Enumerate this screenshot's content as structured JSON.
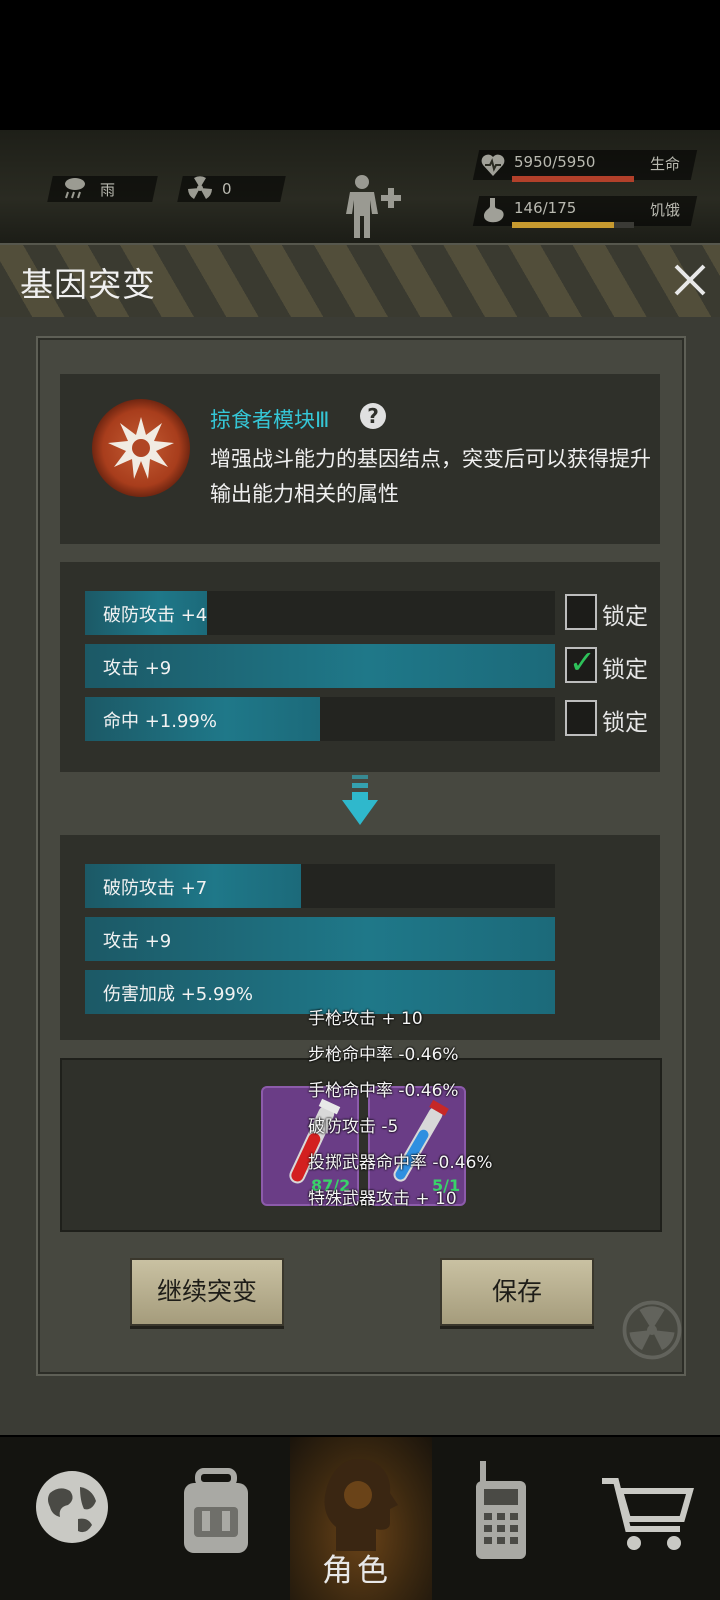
{
  "hud": {
    "weather_label": "雨",
    "radiation_value": "0",
    "hp_text": "5950/5950",
    "hp_label": "生命",
    "hp_fraction": 1.0,
    "hunger_text": "146/175",
    "hunger_label": "饥饿",
    "hunger_fraction": 0.834,
    "colors": {
      "hp": "#b2402a",
      "hunger": "#c79a2f"
    }
  },
  "modal": {
    "title": "基因突变",
    "gene": {
      "name": "掠食者模块Ⅲ",
      "help_symbol": "?",
      "description": "增强战斗能力的基因结点，突变后可以获得提升输出能力相关的属性"
    },
    "current_attributes": [
      {
        "label": "破防攻击 +4",
        "fill": 0.26,
        "lock_label": "锁定",
        "locked": false
      },
      {
        "label": "攻击 +9",
        "fill": 1.0,
        "lock_label": "锁定",
        "locked": true
      },
      {
        "label": "命中 +1.99%",
        "fill": 0.5,
        "lock_label": "锁定",
        "locked": false
      }
    ],
    "new_attributes": [
      {
        "label": "破防攻击 +7",
        "fill": 0.46
      },
      {
        "label": "攻击 +9",
        "fill": 1.0
      },
      {
        "label": "伤害加成 +5.99%",
        "fill": 1.0
      }
    ],
    "materials": [
      {
        "icon": "red-vial-icon",
        "count": "87/2"
      },
      {
        "icon": "blue-vial-icon",
        "count": "5/1"
      }
    ],
    "tooltip_lines": [
      "手枪攻击 + 10",
      "步枪命中率 -0.46%",
      "手枪命中率 -0.46%",
      "破防攻击 -5",
      "投掷武器命中率 -0.46%",
      "特殊武器攻击 + 10"
    ],
    "buttons": {
      "continue": "继续突变",
      "save": "保存"
    }
  },
  "nav": {
    "items": [
      {
        "icon": "globe-icon",
        "label": ""
      },
      {
        "icon": "backpack-icon",
        "label": ""
      },
      {
        "icon": "character-icon",
        "label": "角色",
        "active": true
      },
      {
        "icon": "walkie-talkie-icon",
        "label": ""
      },
      {
        "icon": "cart-icon",
        "label": ""
      }
    ]
  }
}
